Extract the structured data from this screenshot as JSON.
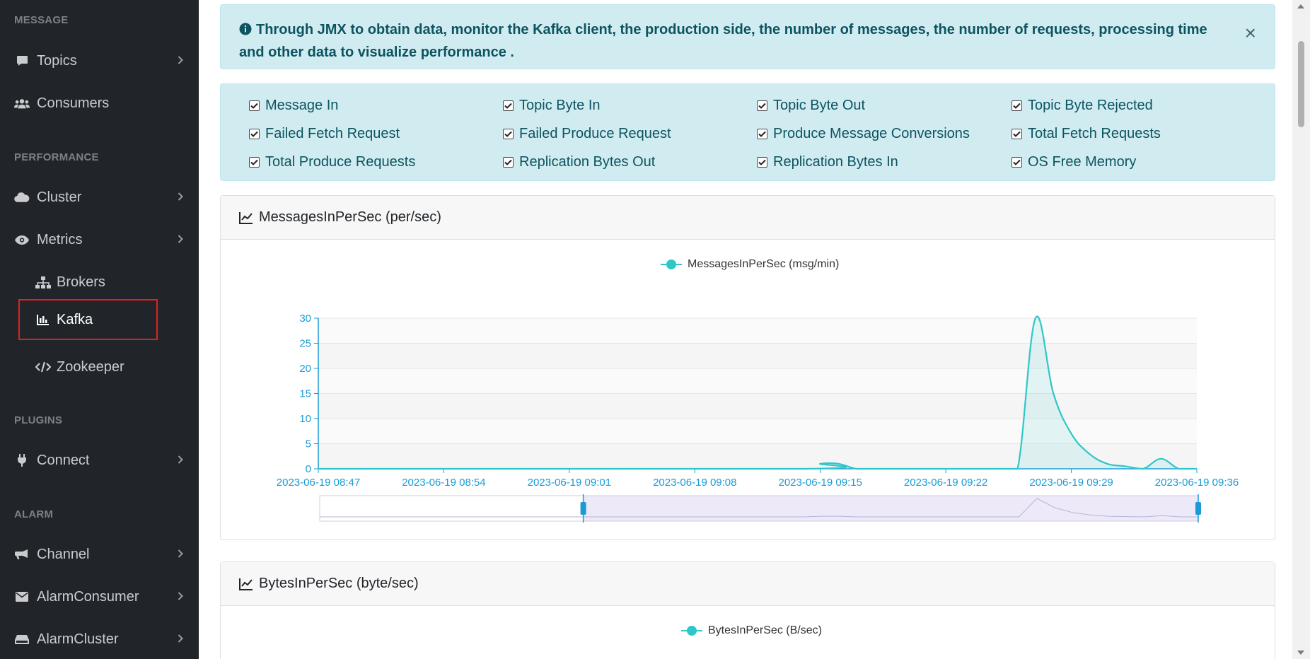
{
  "sidebar": {
    "sections": {
      "message": "MESSAGE",
      "performance": "PERFORMANCE",
      "plugins": "PLUGINS",
      "alarm": "ALARM"
    },
    "items": {
      "topics": "Topics",
      "consumers": "Consumers",
      "cluster": "Cluster",
      "metrics": "Metrics",
      "brokers": "Brokers",
      "kafka": "Kafka",
      "zookeeper": "Zookeeper",
      "connect": "Connect",
      "channel": "Channel",
      "alarm_consumer": "AlarmConsumer",
      "alarm_cluster": "AlarmCluster"
    },
    "active_item": "Kafka"
  },
  "alert": {
    "text": "Through JMX to obtain data, monitor the Kafka client, the production side, the number of messages, the number of requests, processing time and other data to visualize performance .",
    "close_label": "×"
  },
  "metric_options": [
    {
      "label": "Message In",
      "checked": true
    },
    {
      "label": "Topic Byte In",
      "checked": true
    },
    {
      "label": "Topic Byte Out",
      "checked": true
    },
    {
      "label": "Topic Byte Rejected",
      "checked": true
    },
    {
      "label": "Failed Fetch Request",
      "checked": true
    },
    {
      "label": "Failed Produce Request",
      "checked": true
    },
    {
      "label": "Produce Message Conversions",
      "checked": true
    },
    {
      "label": "Total Fetch Requests",
      "checked": true
    },
    {
      "label": "Total Produce Requests",
      "checked": true
    },
    {
      "label": "Replication Bytes Out",
      "checked": true
    },
    {
      "label": "Replication Bytes In",
      "checked": true
    },
    {
      "label": "OS Free Memory",
      "checked": true
    }
  ],
  "cards": {
    "messages": {
      "title": "MessagesInPerSec (per/sec)",
      "legend": "MessagesInPerSec (msg/min)"
    },
    "bytes": {
      "title": "BytesInPerSec (byte/sec)",
      "legend": "BytesInPerSec (B/sec)"
    }
  },
  "colors": {
    "sidebar_bg": "#212529",
    "alert_bg": "#d1ecf1",
    "alert_text": "#0c5460",
    "series": "#2ec7c9",
    "axis": "#1a9bd7",
    "active_outline": "#e02020"
  },
  "chart_data": {
    "type": "line",
    "legend": [
      "MessagesInPerSec (msg/min)"
    ],
    "xlabel": "",
    "ylabel": "",
    "ylim": [
      0,
      30
    ],
    "yticks": [
      0,
      5,
      10,
      15,
      20,
      25,
      30
    ],
    "xticks": [
      "2023-06-19 08:47",
      "2023-06-19 08:54",
      "2023-06-19 09:01",
      "2023-06-19 09:08",
      "2023-06-19 09:15",
      "2023-06-19 09:22",
      "2023-06-19 09:29",
      "2023-06-19 09:36"
    ],
    "x_range_min": [
      0,
      49
    ],
    "grid": true,
    "smooth": true,
    "area_fill": true,
    "series": [
      {
        "name": "MessagesInPerSec (msg/min)",
        "x_min": [
          0,
          27,
          28,
          29,
          30,
          31,
          32,
          38,
          39,
          40,
          41,
          42,
          43,
          44,
          45,
          46,
          47,
          48,
          49
        ],
        "values": [
          0,
          0,
          1,
          1,
          0,
          0,
          0,
          0,
          0,
          30,
          15,
          7,
          3,
          1,
          0.5,
          0,
          2,
          0,
          0
        ]
      }
    ],
    "data_zoom": {
      "start_fraction": 0.3,
      "end_fraction": 1.0
    }
  }
}
